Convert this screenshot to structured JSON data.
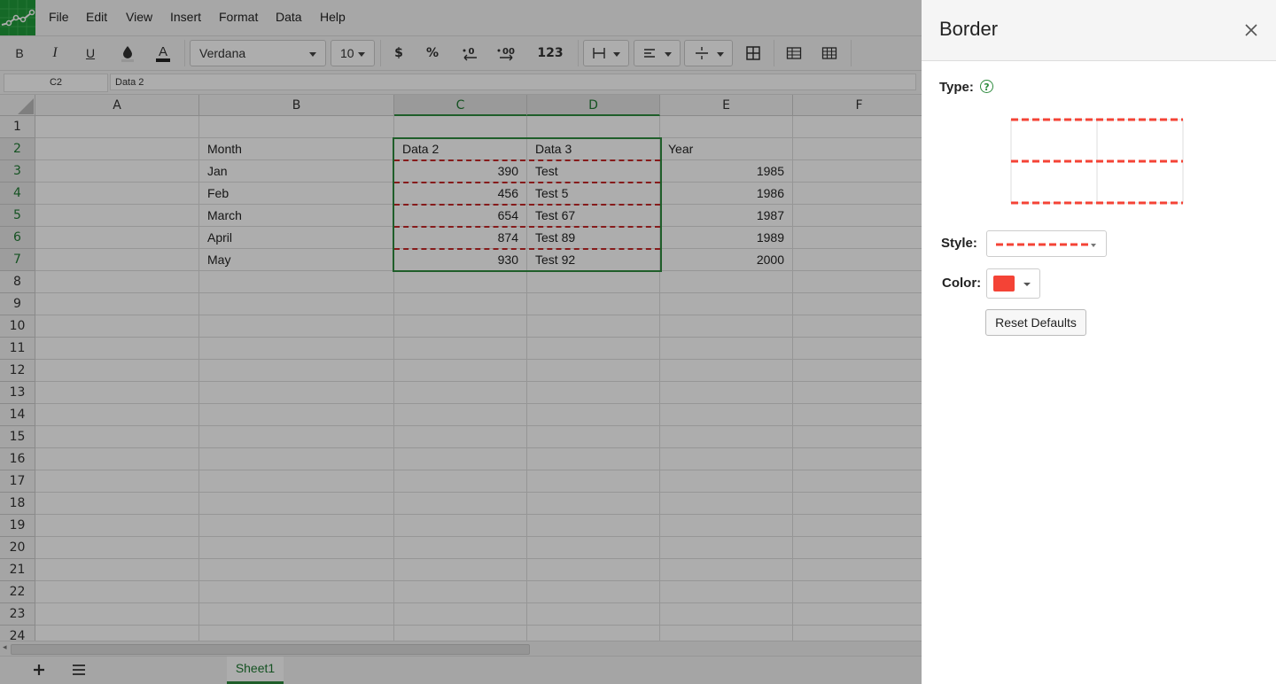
{
  "menubar": {
    "items": [
      {
        "id": "file",
        "label": "File"
      },
      {
        "id": "edit",
        "label": "Edit"
      },
      {
        "id": "view",
        "label": "View"
      },
      {
        "id": "insert",
        "label": "Insert"
      },
      {
        "id": "format",
        "label": "Format"
      },
      {
        "id": "data",
        "label": "Data"
      },
      {
        "id": "help",
        "label": "Help"
      }
    ]
  },
  "toolbar": {
    "bold": "B",
    "italic": "I",
    "underline": "U",
    "font_family": "Verdana",
    "font_size": "10",
    "currency": "$",
    "percent": "%",
    "number_format": "123"
  },
  "formula_bar": {
    "cell_ref": "C2",
    "value": "Data 2"
  },
  "grid": {
    "columns": [
      "A",
      "B",
      "C",
      "D",
      "E",
      "F"
    ],
    "rows": [
      "1",
      "2",
      "3",
      "4",
      "5",
      "6",
      "7",
      "8",
      "9",
      "10",
      "11",
      "12",
      "13",
      "14",
      "15",
      "16",
      "17",
      "18",
      "19",
      "20",
      "21",
      "22",
      "23",
      "24"
    ],
    "header_row": {
      "b": "Month",
      "c": "Data 2",
      "d": "Data 3",
      "e": "Year"
    },
    "data_rows": [
      {
        "b": "Jan",
        "c": "390",
        "d": "Test",
        "e": "1985"
      },
      {
        "b": "Feb",
        "c": "456",
        "d": "Test 5",
        "e": "1986"
      },
      {
        "b": "March",
        "c": "654",
        "d": "Test 67",
        "e": "1987"
      },
      {
        "b": "April",
        "c": "874",
        "d": "Test 89",
        "e": "1989"
      },
      {
        "b": "May",
        "c": "930",
        "d": "Test 92",
        "e": "2000"
      }
    ]
  },
  "sheets": {
    "active": "Sheet1"
  },
  "border_panel": {
    "title": "Border",
    "type_label": "Type:",
    "style_label": "Style:",
    "color_label": "Color:",
    "reset_label": "Reset Defaults",
    "selected_color": "#f44336"
  },
  "colors": {
    "accent": "#2e8b3e",
    "border_dash": "#c62828"
  }
}
